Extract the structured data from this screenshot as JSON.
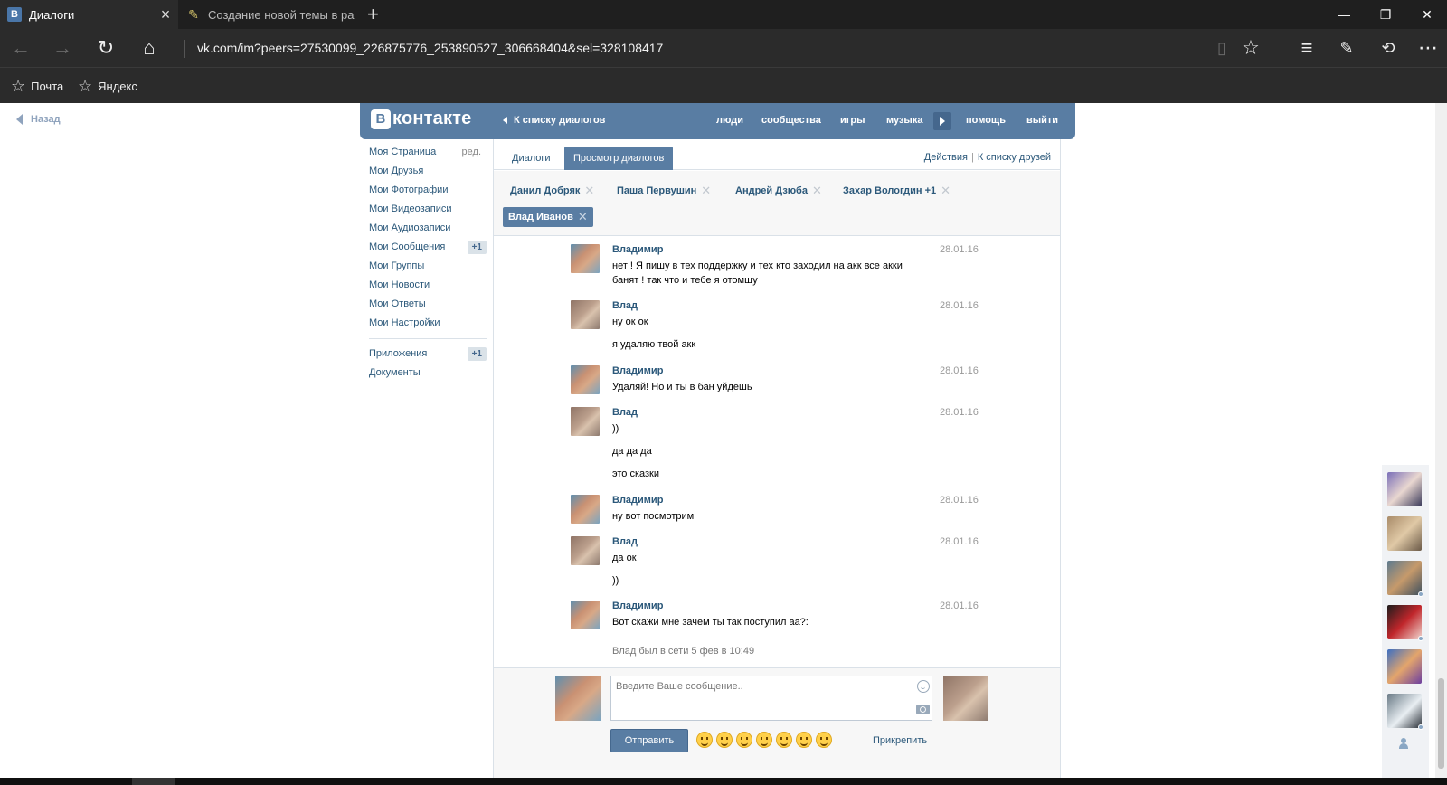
{
  "browser": {
    "tabs": [
      {
        "title": "Диалоги",
        "favicon": "В",
        "active": true
      },
      {
        "title": "Создание новой темы в ра",
        "active": false
      }
    ],
    "url": "vk.com/im?peers=27530099_226875776_253890527_306668404&sel=328108417",
    "favorites": [
      "Почта",
      "Яндекс"
    ]
  },
  "page": {
    "back_label": "Назад"
  },
  "header": {
    "logo_text": "контакте",
    "logo_mark": "В",
    "to_dialogs": "К списку диалогов",
    "nav": [
      "люди",
      "сообщества",
      "игры",
      "музыка",
      "помощь",
      "выйти"
    ]
  },
  "sidebar": {
    "items": [
      {
        "label": "Моя Страница",
        "extra": "ред."
      },
      {
        "label": "Мои Друзья"
      },
      {
        "label": "Мои Фотографии"
      },
      {
        "label": "Мои Видеозаписи"
      },
      {
        "label": "Мои Аудиозаписи"
      },
      {
        "label": "Мои Сообщения",
        "badge": "+1"
      },
      {
        "label": "Мои Группы"
      },
      {
        "label": "Мои Новости"
      },
      {
        "label": "Мои Ответы"
      },
      {
        "label": "Мои Настройки"
      }
    ],
    "items2": [
      {
        "label": "Приложения",
        "badge": "+1"
      },
      {
        "label": "Документы"
      }
    ]
  },
  "tabs": {
    "dialogs": "Диалоги",
    "view": "Просмотр диалогов",
    "actions": "Действия",
    "to_friends": "К списку друзей"
  },
  "peers": [
    "Данил Добряк",
    "Паша Первушин",
    "Андрей Дзюба",
    "Захар Вологдин +1",
    "Влад Иванов"
  ],
  "messages": [
    {
      "author": "Владимир",
      "date": "28.01.16",
      "lines": [
        "нет ! Я пишу в тех поддержку и тех кто заходил на акк все акки",
        "банят ! так что и тебе я отомщу"
      ]
    },
    {
      "author": "Влад",
      "date": "28.01.16",
      "lines": [
        "ну ок ок",
        "я удаляю твой акк"
      ]
    },
    {
      "author": "Владимир",
      "date": "28.01.16",
      "lines": [
        "Удаляй! Но и ты в бан уйдешь"
      ]
    },
    {
      "author": "Влад",
      "date": "28.01.16",
      "lines": [
        "))",
        "да да да",
        "это сказки"
      ]
    },
    {
      "author": "Владимир",
      "date": "28.01.16",
      "lines": [
        "ну вот посмотрим"
      ]
    },
    {
      "author": "Влад",
      "date": "28.01.16",
      "lines": [
        "да ок",
        "))"
      ]
    },
    {
      "author": "Владимир",
      "date": "28.01.16",
      "lines": [
        "Вот скажи мне зачем ты так поступил аа?:"
      ]
    }
  ],
  "online_status": "Влад был в сети 5 фев в 10:49",
  "composer": {
    "placeholder": "Введите Ваше сообщение..",
    "send": "Отправить",
    "attach": "Прикрепить"
  },
  "colors": {
    "vk_blue": "#597da3",
    "link": "#2b587a"
  }
}
